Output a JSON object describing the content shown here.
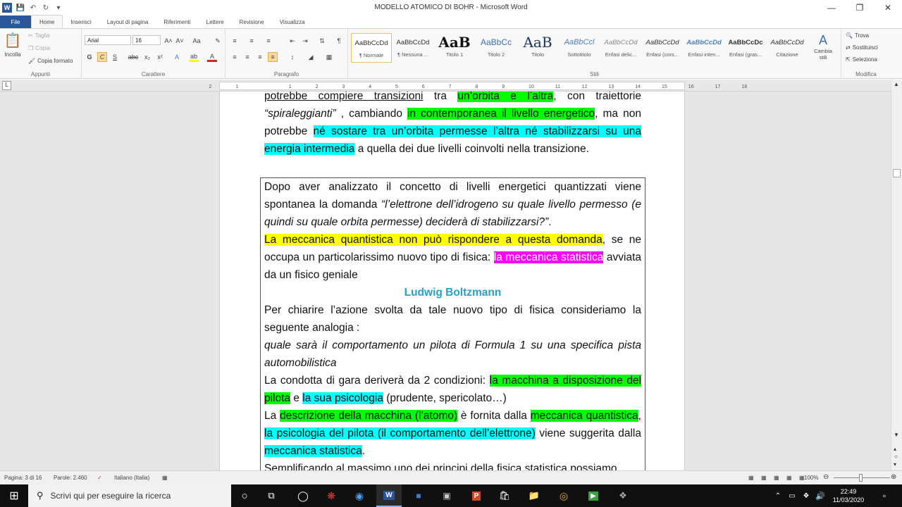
{
  "window": {
    "title": "MODELLO ATOMICO DI BOHR - Microsoft Word",
    "app_icon": "W",
    "controls": [
      "—",
      "❐",
      "✕"
    ]
  },
  "quick_access": [
    "save-icon",
    "undo-icon",
    "redo-icon",
    "customize-icon"
  ],
  "tabs": [
    "File",
    "Home",
    "Inserisci",
    "Layout di pagina",
    "Riferimenti",
    "Lettere",
    "Revisione",
    "Visualizza"
  ],
  "ribbon": {
    "appunti": {
      "label": "Appunti",
      "paste": "Incolla",
      "cut": "Taglia",
      "copy": "Copia",
      "format_painter": "Copia formato"
    },
    "carattere": {
      "label": "Carattere",
      "font": "Arial",
      "size": "16",
      "bold": "G",
      "italic": "C",
      "underline": "S",
      "strike": "abc",
      "sub": "x₂",
      "sup": "x²",
      "grow": "A˄",
      "shrink": "A˅",
      "case": "Aa",
      "clear": "✎",
      "effects": "A",
      "highlight": "ab",
      "color": "A"
    },
    "paragrafo": {
      "label": "Paragrafo"
    },
    "stili": {
      "label": "Stili",
      "items": [
        {
          "preview": "AaBbCcDd",
          "name": "¶ Normale"
        },
        {
          "preview": "AaBbCcDd",
          "name": "¶ Nessuna ..."
        },
        {
          "preview": "AaB",
          "name": "Titolo 1"
        },
        {
          "preview": "AaBbCc",
          "name": "Titolo 2"
        },
        {
          "preview": "AaB",
          "name": "Titolo"
        },
        {
          "preview": "AaBbCcl",
          "name": "Sottotitolo"
        },
        {
          "preview": "AaBbCcDd",
          "name": "Enfasi delic..."
        },
        {
          "preview": "AaBbCcDd",
          "name": "Enfasi (cors..."
        },
        {
          "preview": "AaBbCcDd",
          "name": "Enfasi inten..."
        },
        {
          "preview": "AaBbCcDc",
          "name": "Enfasi (gras..."
        },
        {
          "preview": "AaBbCcDd",
          "name": "Citazione"
        }
      ],
      "change": "Cambia stili"
    },
    "modifica": {
      "label": "Modifica",
      "find": "Trova",
      "replace": "Sostituisci",
      "select": "Seleziona"
    }
  },
  "ruler": {
    "ticks": [
      "2",
      "1",
      "1",
      "2",
      "3",
      "4",
      "5",
      "6",
      "7",
      "8",
      "9",
      "10",
      "11",
      "12",
      "13",
      "14",
      "15",
      "16",
      "17",
      "18"
    ]
  },
  "document": {
    "p1": [
      {
        "t": "potrebbe compiere transizioni",
        "s": "u"
      },
      {
        "t": " tra ",
        "s": ""
      },
      {
        "t": "un’orbita e l’altra",
        "s": "hlg"
      },
      {
        "t": ", con traiettorie ",
        "s": ""
      },
      {
        "t": "“spiraleggianti”",
        "s": "i"
      },
      {
        "t": " , cambiando ",
        "s": ""
      },
      {
        "t": "in contemporanea il livello energetico",
        "s": "hlg"
      },
      {
        "t": ", ma non potrebbe ",
        "s": ""
      },
      {
        "t": "né sostare tra un’orbita permesse l’altra né stabilizzarsi su una energia intermedia",
        "s": "hlc"
      },
      {
        "t": " a quella dei due livelli coinvolti nella transizione.",
        "s": ""
      }
    ],
    "p2": [
      {
        "t": "Dopo aver analizzato il concetto di livelli energetici quantizzati viene spontanea la domanda ",
        "s": ""
      },
      {
        "t": "“l’elettrone dell’idrogeno su quale livello permesso (e quindi su quale orbita permesse) deciderà di stabilizzarsi?”",
        "s": "i"
      },
      {
        "t": ".",
        "s": ""
      }
    ],
    "p3": [
      {
        "t": "La meccanica quantistica non può rispondere a questa domanda",
        "s": "hly"
      },
      {
        "t": ", se ne occupa un particolarissimo nuovo tipo di fisica: ",
        "s": ""
      },
      {
        "t": "la meccanica statistica",
        "s": "hlm"
      },
      {
        "t": " avviata da un fisico geniale",
        "s": ""
      }
    ],
    "name": "Ludwig Boltzmann",
    "p4": [
      {
        "t": "Per chiarire l’azione svolta da tale nuovo tipo di fisica consideriamo la seguente analogia :",
        "s": ""
      }
    ],
    "p5": [
      {
        "t": "quale sarà il comportamento un pilota di Formula 1 su una specifica pista automobilistica",
        "s": "i"
      }
    ],
    "p6": [
      {
        "t": "La condotta di gara deriverà da 2 condizioni: ",
        "s": ""
      },
      {
        "t": "la macchina a disposizione del pilota",
        "s": "hlg"
      },
      {
        "t": " e ",
        "s": ""
      },
      {
        "t": "la sua psicologia",
        "s": "hlc"
      },
      {
        "t": " (prudente, spericolato…)",
        "s": ""
      }
    ],
    "p7": [
      {
        "t": "La ",
        "s": ""
      },
      {
        "t": "descrizione della macchina (l’atomo)",
        "s": "hlg"
      },
      {
        "t": " è fornita dalla ",
        "s": ""
      },
      {
        "t": "meccanica quantistica",
        "s": "hlg"
      },
      {
        "t": ", ",
        "s": ""
      },
      {
        "t": "la psicologia del pilota (il comportamento dell’elettrone)",
        "s": "hlc"
      },
      {
        "t": " viene suggerita dalla ",
        "s": ""
      },
      {
        "t": "meccanica statistica",
        "s": "hlc"
      },
      {
        "t": ".",
        "s": ""
      }
    ],
    "p8": [
      {
        "t": "Semplificando al massimo uno dei principi della fisica statistica possiamo",
        "s": ""
      }
    ]
  },
  "status": {
    "page": "Pagina: 3 di 16",
    "words": "Parole: 2.460",
    "language": "Italiano (Italia)",
    "zoom": "100%"
  },
  "taskbar": {
    "search_placeholder": "Scrivi qui per eseguire la ricerca",
    "time": "22:49",
    "date": "11/03/2020"
  }
}
